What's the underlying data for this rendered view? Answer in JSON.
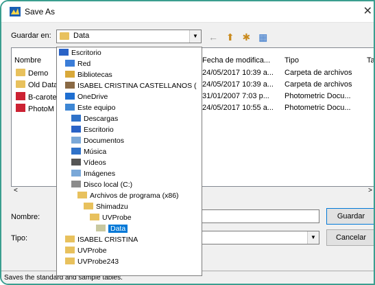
{
  "window": {
    "title": "Save As"
  },
  "save_in": {
    "label": "Guardar en:",
    "value": "Data"
  },
  "columns": {
    "name": "Nombre",
    "date": "Fecha de modifica...",
    "type": "Tipo",
    "size": "Ta"
  },
  "files": [
    {
      "name": "Demo",
      "date": "24/05/2017 10:39 a...",
      "type": "Carpeta de archivos",
      "icon": "folder-icon"
    },
    {
      "name": "Old Data",
      "date": "24/05/2017 10:39 a...",
      "type": "Carpeta de archivos",
      "icon": "folder-icon"
    },
    {
      "name": "B-carote",
      "date": "31/01/2007 7:03 p...",
      "type": "Photometric Docu...",
      "icon": "photometric-doc-icon"
    },
    {
      "name": "PhotoM",
      "date": "24/05/2017 10:55 a...",
      "type": "Photometric Docu...",
      "icon": "photometric-doc-icon"
    }
  ],
  "dropdown_items": [
    {
      "label": "Escritorio",
      "indent": 0,
      "icon": "desktop-icon",
      "color": "#2a63c7"
    },
    {
      "label": "Red",
      "indent": 1,
      "icon": "network-icon",
      "color": "#3b7dd8"
    },
    {
      "label": "Bibliotecas",
      "indent": 1,
      "icon": "libraries-icon",
      "color": "#d9a93a"
    },
    {
      "label": "ISABEL CRISTINA CASTELLANOS (",
      "indent": 1,
      "icon": "user-icon",
      "color": "#8a6a45"
    },
    {
      "label": "OneDrive",
      "indent": 1,
      "icon": "onedrive-icon",
      "color": "#1f6fd1"
    },
    {
      "label": "Este equipo",
      "indent": 1,
      "icon": "computer-icon",
      "color": "#3d86d4"
    },
    {
      "label": "Descargas",
      "indent": 2,
      "icon": "downloads-icon",
      "color": "#2f72c9"
    },
    {
      "label": "Escritorio",
      "indent": 2,
      "icon": "desktop-icon",
      "color": "#2a63c7"
    },
    {
      "label": "Documentos",
      "indent": 2,
      "icon": "documents-icon",
      "color": "#7aa8d8"
    },
    {
      "label": "Música",
      "indent": 2,
      "icon": "music-icon",
      "color": "#2f72c9"
    },
    {
      "label": "Vídeos",
      "indent": 2,
      "icon": "videos-icon",
      "color": "#555555"
    },
    {
      "label": "Imágenes",
      "indent": 2,
      "icon": "pictures-icon",
      "color": "#7aa8d8"
    },
    {
      "label": "Disco local (C:)",
      "indent": 2,
      "icon": "drive-icon",
      "color": "#8c8c8c"
    },
    {
      "label": "Archivos de programa (x86)",
      "indent": 3,
      "icon": "folder-icon",
      "color": "#e8c15d"
    },
    {
      "label": "Shimadzu",
      "indent": 4,
      "icon": "folder-icon",
      "color": "#e8c15d"
    },
    {
      "label": "UVProbe",
      "indent": 5,
      "icon": "folder-icon",
      "color": "#e8c15d"
    },
    {
      "label": "Data",
      "indent": 6,
      "icon": "folder-open-icon",
      "color": "#c8c8a0",
      "selected": true
    },
    {
      "label": "ISABEL CRISTINA",
      "indent": 1,
      "icon": "folder-icon",
      "color": "#e8c15d"
    },
    {
      "label": "UVProbe",
      "indent": 1,
      "icon": "folder-icon",
      "color": "#e8c15d"
    },
    {
      "label": "UVProbe243",
      "indent": 1,
      "icon": "folder-icon",
      "color": "#e8c15d"
    }
  ],
  "name_field": {
    "label": "Nombre:",
    "value": ""
  },
  "type_field": {
    "label": "Tipo:",
    "value": ""
  },
  "buttons": {
    "save": "Guardar",
    "cancel": "Cancelar"
  },
  "status": {
    "text": "Saves the standard and sample tables."
  },
  "colors": {
    "accent": "#0078d7",
    "frame": "#3a9e8f"
  }
}
